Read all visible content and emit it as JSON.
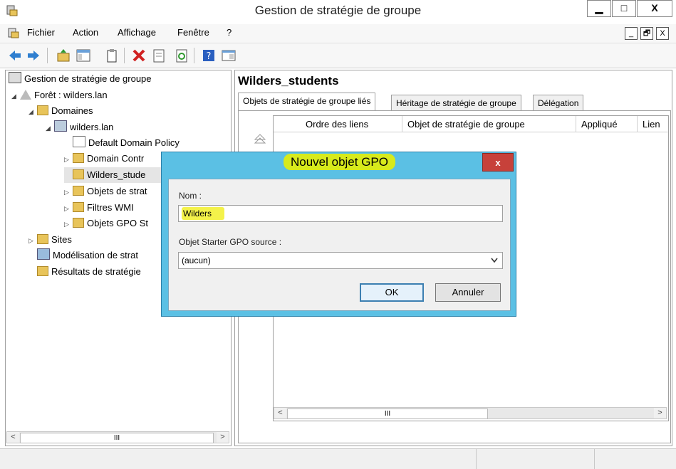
{
  "window": {
    "title": "Gestion de stratégie de groupe",
    "minimize": "▁",
    "maximize": "□",
    "close": "X"
  },
  "menu": {
    "items": [
      "Fichier",
      "Action",
      "Affichage",
      "Fenêtre",
      "?"
    ],
    "mdi_minimize": "_",
    "mdi_restore": "🗗",
    "mdi_close": "X"
  },
  "tree": {
    "root": "Gestion de stratégie de groupe",
    "forest": "Forêt : wilders.lan",
    "domains": "Domaines",
    "domain": "wilders.lan",
    "items": [
      "Default Domain Policy",
      "Domain Contr",
      "Wilders_stude",
      "Objets de strat",
      "Filtres WMI",
      "Objets GPO St"
    ],
    "sites": "Sites",
    "modeling": "Modélisation de strat",
    "results": "Résultats de stratégie"
  },
  "right": {
    "title": "Wilders_students",
    "tabs": [
      "Objets de stratégie de groupe liés",
      "Héritage de stratégie de groupe",
      "Délégation"
    ],
    "columns": [
      "Ordre des liens",
      "Objet de stratégie de groupe",
      "Appliqué",
      "Lien"
    ]
  },
  "scroll": {
    "left": "<",
    "right": ">",
    "thumb": "III"
  },
  "dialog": {
    "title": "Nouvel objet GPO",
    "close": "x",
    "name_label": "Nom :",
    "name_value": "Wilders",
    "starter_label": "Objet Starter GPO source :",
    "starter_value": "(aucun)",
    "ok": "OK",
    "cancel": "Annuler"
  },
  "colors": {
    "dialog_frame": "#5bc0e4",
    "highlight": "#d7ea1c",
    "close_red": "#c7413a"
  }
}
